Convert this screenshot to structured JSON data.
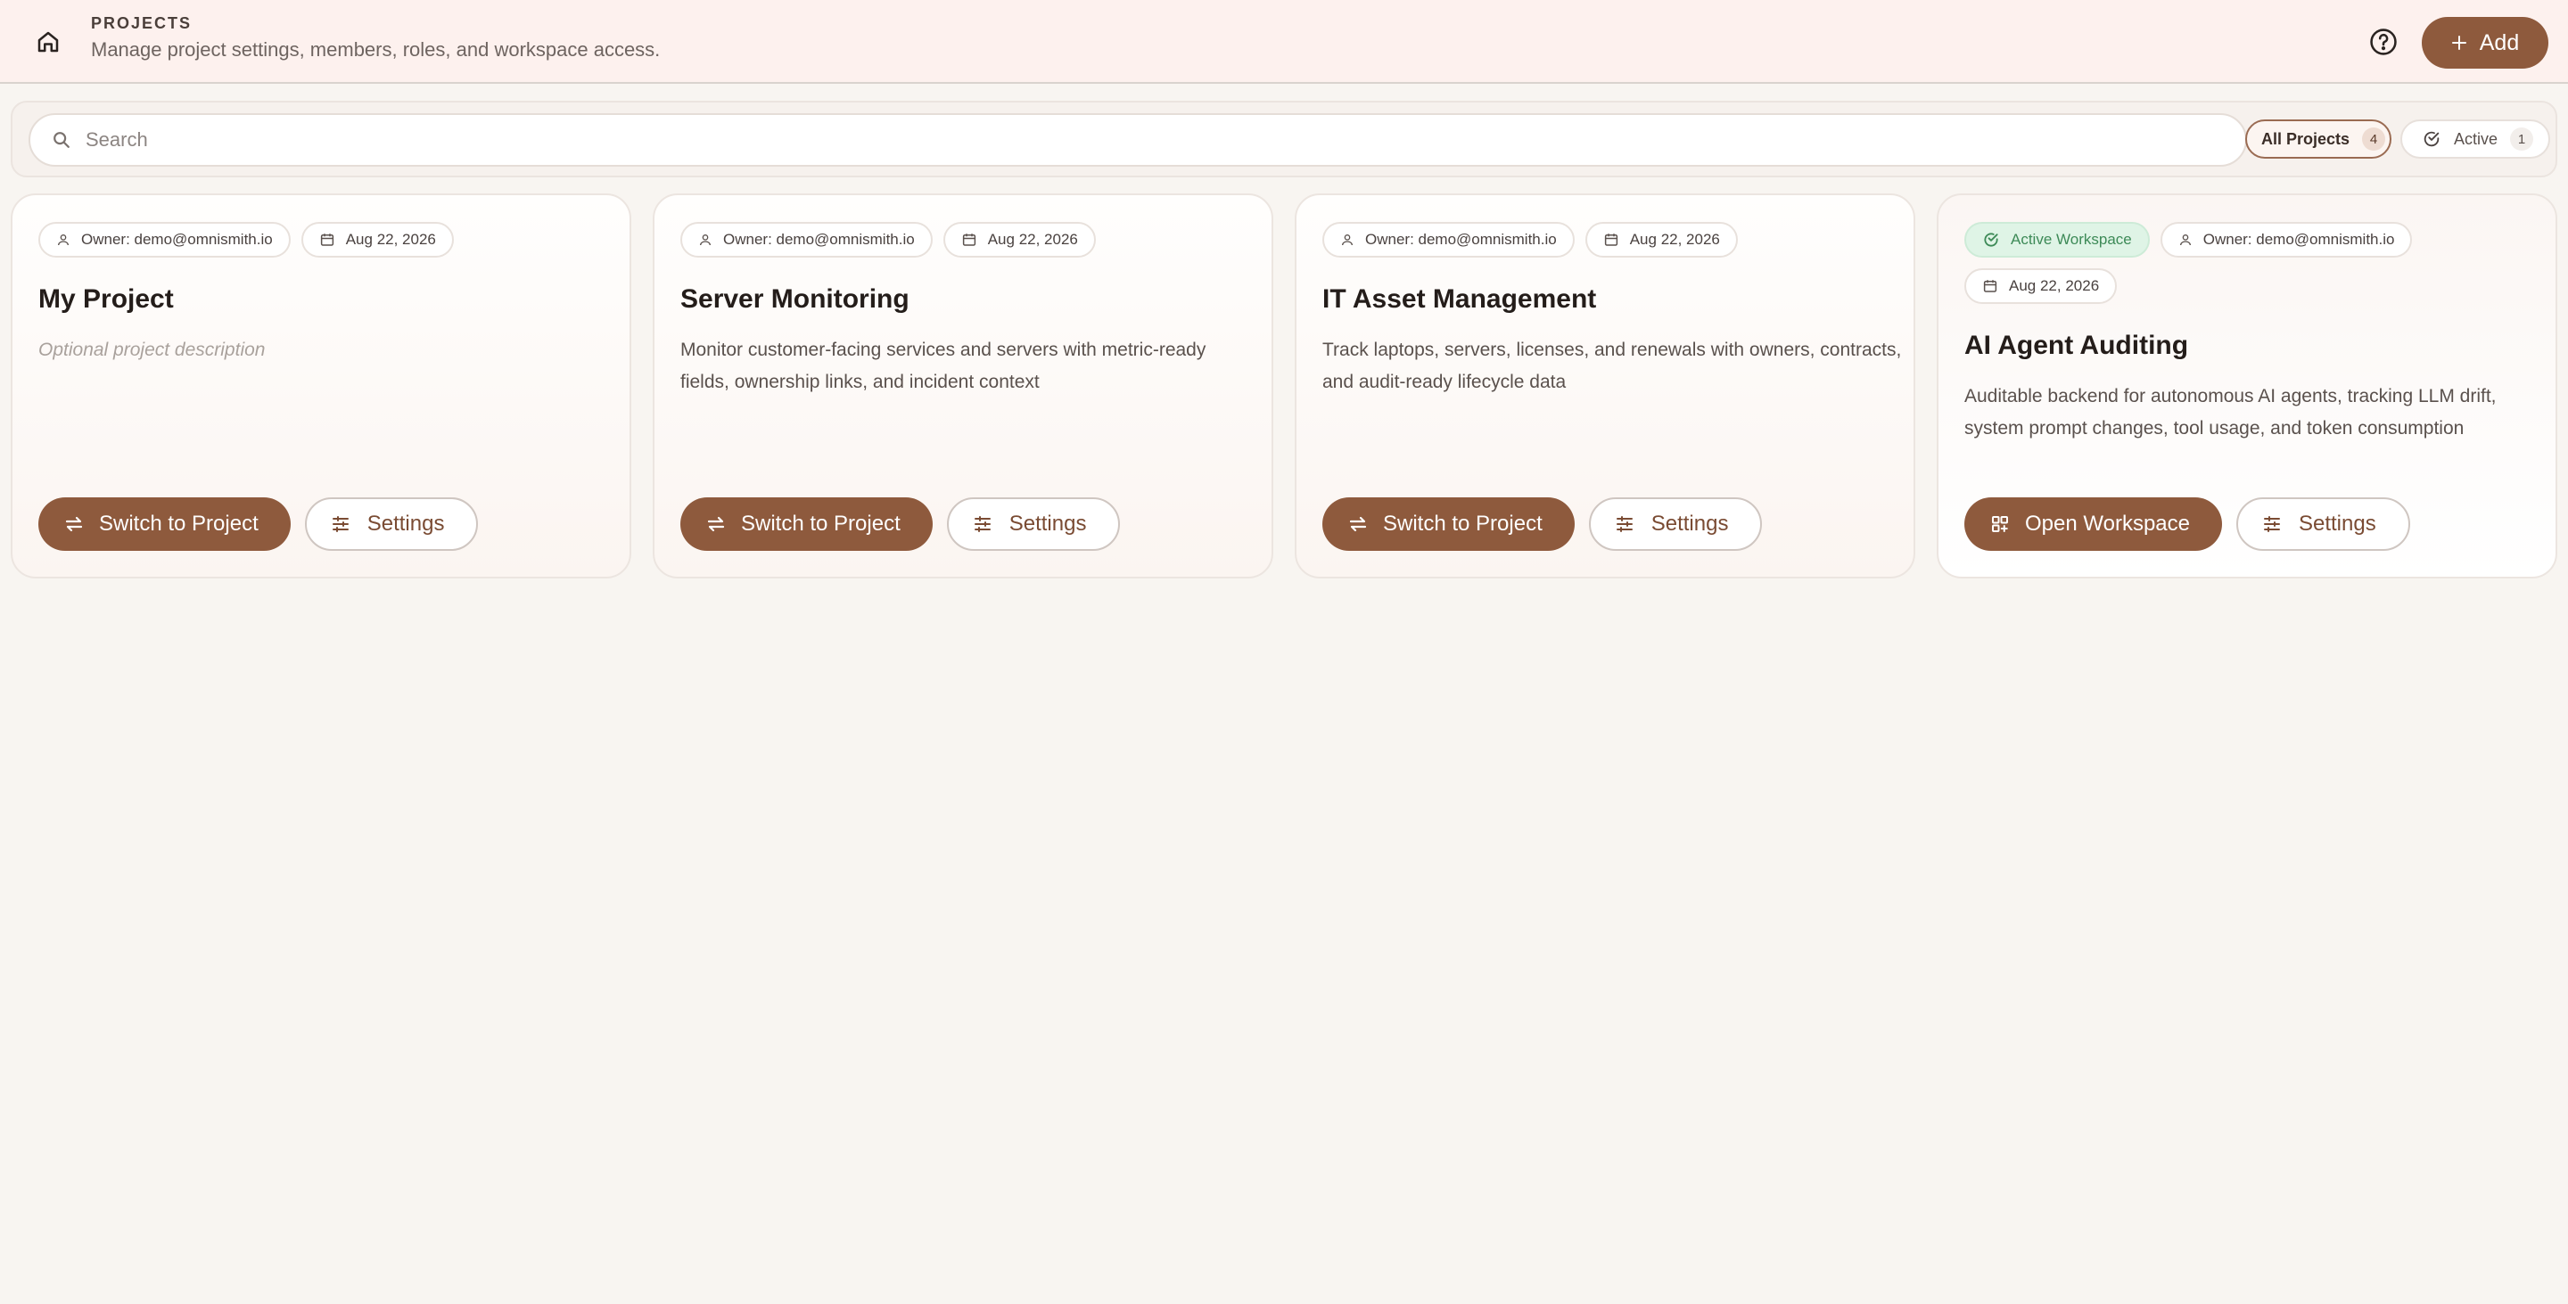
{
  "header": {
    "title": "PROJECTS",
    "subtitle": "Manage project settings, members, roles, and workspace access.",
    "add_label": "Add",
    "icons": {
      "home": "home-icon",
      "help": "help-circle-icon",
      "add": "plus-icon"
    }
  },
  "search": {
    "placeholder": "Search",
    "value": ""
  },
  "filters": [
    {
      "label": "All Projects",
      "count": "4",
      "selected": true
    },
    {
      "label": "Active",
      "count": "1",
      "selected": false,
      "icon": "check-circle-icon"
    }
  ],
  "projects": [
    {
      "owner": "Owner: demo@omnismith.io",
      "date": "Aug 22, 2026",
      "title": "My Project",
      "description": "Optional project description",
      "description_is_placeholder": true,
      "primary_label": "Switch to Project",
      "primary_icon": "switch-arrows-icon",
      "settings_label": "Settings"
    },
    {
      "owner": "Owner: demo@omnismith.io",
      "date": "Aug 22, 2026",
      "title": "Server Monitoring",
      "description": "Monitor customer-facing services and servers with metric-ready fields, ownership links, and incident context",
      "primary_label": "Switch to Project",
      "primary_icon": "switch-arrows-icon",
      "settings_label": "Settings"
    },
    {
      "owner": "Owner: demo@omnismith.io",
      "date": "Aug 22, 2026",
      "title": "IT Asset Management",
      "description": "Track laptops, servers, licenses, and renewals with owners, contracts, and audit-ready lifecycle data",
      "primary_label": "Switch to Project",
      "primary_icon": "switch-arrows-icon",
      "settings_label": "Settings"
    },
    {
      "badge": "Active Workspace",
      "owner": "Owner: demo@omnismith.io",
      "date": "Aug 22, 2026",
      "title": "AI Agent Auditing",
      "description": "Auditable backend for autonomous AI agents, tracking LLM drift, system prompt changes, tool usage, and token consumption",
      "primary_label": "Open Workspace",
      "primary_icon": "grid-plus-icon",
      "settings_label": "Settings"
    }
  ],
  "colors": {
    "accent": "#8e5a3d",
    "header_bg": "#fdf1ee",
    "page_bg": "#f8f5f1",
    "active_badge_bg": "#dff4e6",
    "active_badge_text": "#3d8a57"
  }
}
